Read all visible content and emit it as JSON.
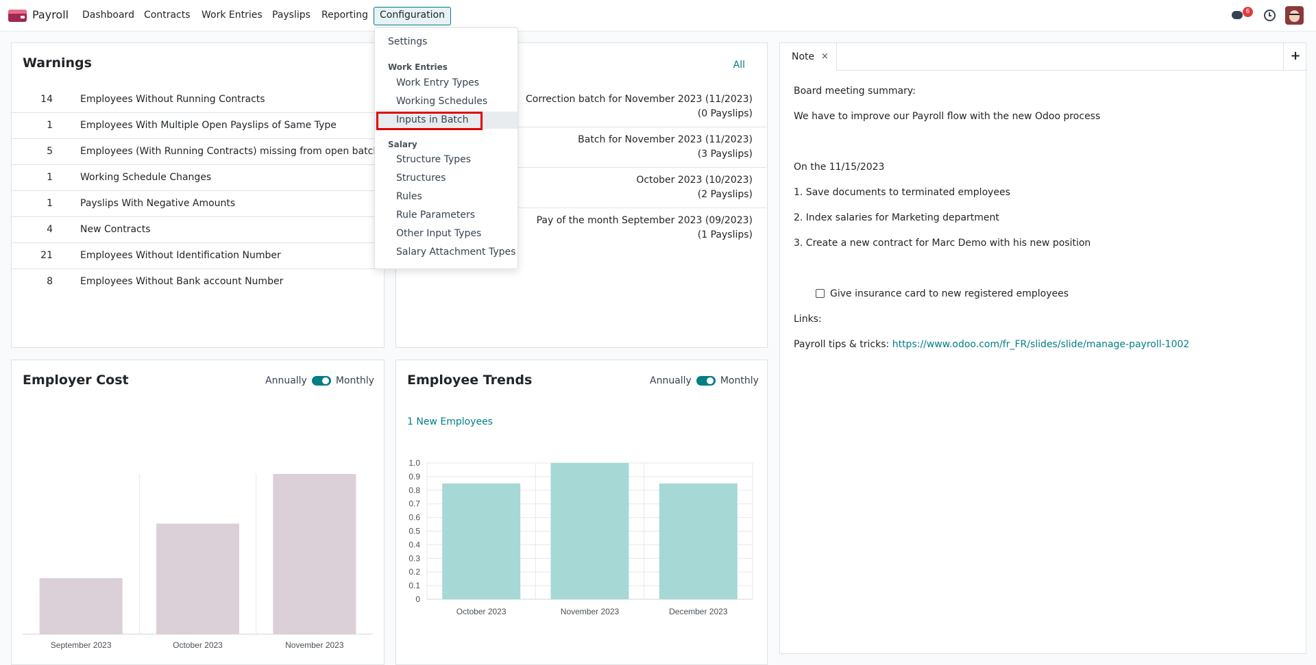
{
  "navbar": {
    "app_name": "Payroll",
    "menu": [
      "Dashboard",
      "Contracts",
      "Work Entries",
      "Payslips",
      "Reporting"
    ],
    "active_menu": "Configuration",
    "chat_badge": "6"
  },
  "config_menu": {
    "settings": "Settings",
    "work_entries_header": "Work Entries",
    "work_entry_types": "Work Entry Types",
    "working_schedules": "Working Schedules",
    "inputs_in_batch": "Inputs in Batch",
    "salary_header": "Salary",
    "structure_types": "Structure Types",
    "structures": "Structures",
    "rules": "Rules",
    "rule_parameters": "Rule Parameters",
    "other_input_types": "Other Input Types",
    "salary_attachment_types": "Salary Attachment Types"
  },
  "warnings": {
    "title": "Warnings",
    "rows": [
      {
        "count": "14",
        "label": "Employees Without Running Contracts"
      },
      {
        "count": "1",
        "label": "Employees With Multiple Open Payslips of Same Type"
      },
      {
        "count": "5",
        "label": "Employees (With Running Contracts) missing from open batches"
      },
      {
        "count": "1",
        "label": "Working Schedule Changes"
      },
      {
        "count": "1",
        "label": "Payslips With Negative Amounts"
      },
      {
        "count": "4",
        "label": "New Contracts"
      },
      {
        "count": "21",
        "label": "Employees Without Identification Number"
      },
      {
        "count": "8",
        "label": "Employees Without Bank account Number"
      }
    ]
  },
  "batches": {
    "all_label": "All",
    "rows": [
      {
        "name": "Correction batch for November 2023 (11/2023)",
        "count": "(0 Payslips)"
      },
      {
        "name": "Batch for November 2023 (11/2023)",
        "count": "(3 Payslips)"
      },
      {
        "name": "October 2023 (10/2023)",
        "count": "(2 Payslips)"
      },
      {
        "name": "Pay of the month September 2023 (09/2023)",
        "count": "(1 Payslips)"
      }
    ]
  },
  "employer_cost": {
    "title": "Employer Cost",
    "toggle_left": "Annually",
    "toggle_right": "Monthly"
  },
  "employee_trends": {
    "title": "Employee Trends",
    "toggle_left": "Annually",
    "toggle_right": "Monthly",
    "new_employees_link": "1 New Employees"
  },
  "note": {
    "tab_label": "Note",
    "tab_close": "×",
    "add_label": "+",
    "lines": {
      "l1": "Board meeting summary:",
      "l2": "We have to improve our Payroll flow with the new Odoo process",
      "l3": "On the 11/15/2023",
      "l4": "1. Save documents to terminated employees",
      "l5": "2. Index salaries for Marketing department",
      "l6": "3. Create a new contract for Marc Demo with his new position",
      "checkbox": "Give insurance card to new registered employees",
      "links": "Links:",
      "tips_prefix": "Payroll tips & tricks:",
      "tips_url": "https://www.odoo.com/fr_FR/slides/slide/manage-payroll-1002"
    }
  },
  "colors": {
    "accent": "#017e84",
    "employer_bar": "#dbd0d8",
    "trends_bar": "#a6d8d6",
    "highlight_box": "#e00000",
    "badge": "#e03c3c"
  },
  "chart_data": [
    {
      "type": "bar",
      "title": "Employer Cost",
      "categories": [
        "September 2023",
        "October 2023",
        "November 2023"
      ],
      "values": [
        0.35,
        0.69,
        1.0
      ],
      "ylim": [
        0,
        1.0
      ],
      "grid": false
    },
    {
      "type": "bar",
      "title": "Employee Trends",
      "categories": [
        "October 2023",
        "November 2023",
        "December 2023"
      ],
      "values": [
        0.85,
        1.0,
        0.85
      ],
      "yticks": [
        "0",
        "0.1",
        "0.2",
        "0.3",
        "0.4",
        "0.5",
        "0.6",
        "0.7",
        "0.8",
        "0.9",
        "1.0"
      ],
      "ylim": [
        0,
        1.0
      ],
      "grid": true
    }
  ]
}
